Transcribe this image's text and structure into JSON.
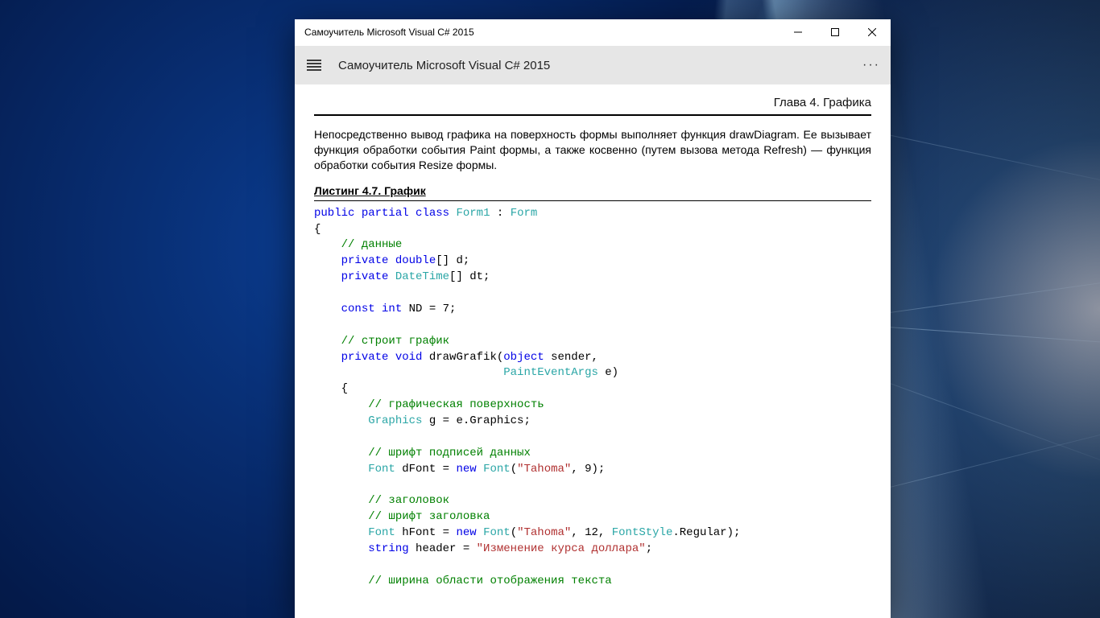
{
  "window": {
    "title": "Самоучитель Microsoft Visual C# 2015"
  },
  "toolbar": {
    "title": "Самоучитель Microsoft Visual C# 2015"
  },
  "chapter": "Глава 4. Графика",
  "intro_paragraph": "Непосредственно вывод графика на поверхность формы выполняет функция drawDiagram. Ее вызывает функция обработки события Paint формы, а также косвенно (путем вызова метода Refresh) — функция обработки события Resize формы.",
  "listing_title": "Листинг 4.7. График",
  "code": {
    "l01": {
      "k1": "public",
      "k2": "partial",
      "k3": "class",
      "t1": "Form1",
      "p": " : ",
      "t2": "Form"
    },
    "l02": "{",
    "l03": {
      "indent": "    ",
      "c": "// данные"
    },
    "l04": {
      "indent": "    ",
      "k1": "private",
      "k2": "double",
      "rest": "[] d;"
    },
    "l05": {
      "indent": "    ",
      "k1": "private",
      "t": "DateTime",
      "rest": "[] dt;"
    },
    "l07": {
      "indent": "    ",
      "k1": "const",
      "k2": "int",
      "rest": " ND = 7;"
    },
    "l09": {
      "indent": "    ",
      "c": "// строит график"
    },
    "l10": {
      "indent": "    ",
      "k1": "private",
      "k2": "void",
      "name": " drawGrafik(",
      "k3": "object",
      "rest": " sender,"
    },
    "l11": {
      "indent": "                            ",
      "t": "PaintEventArgs",
      "rest": " e)"
    },
    "l12": {
      "indent": "    ",
      "txt": "{"
    },
    "l13": {
      "indent": "        ",
      "c": "// графическая поверхность"
    },
    "l14": {
      "indent": "        ",
      "t": "Graphics",
      "rest": " g = e.Graphics;"
    },
    "l16": {
      "indent": "        ",
      "c": "// шрифт подписей данных"
    },
    "l17": {
      "indent": "        ",
      "t1": "Font",
      "mid": " dFont = ",
      "k": "new",
      "sp": " ",
      "t2": "Font",
      "open": "(",
      "s": "\"Tahoma\"",
      "rest": ", 9);"
    },
    "l19": {
      "indent": "        ",
      "c": "// заголовок"
    },
    "l20": {
      "indent": "        ",
      "c": "// шрифт заголовка"
    },
    "l21": {
      "indent": "        ",
      "t1": "Font",
      "mid": " hFont = ",
      "k": "new",
      "sp": " ",
      "t2": "Font",
      "open": "(",
      "s": "\"Tahoma\"",
      "comma": ", 12, ",
      "t3": "FontStyle",
      "rest": ".Regular);"
    },
    "l22": {
      "indent": "        ",
      "k": "string",
      "mid": " header = ",
      "s": "\"Изменение курса доллара\"",
      "rest": ";"
    },
    "l24": {
      "indent": "        ",
      "c": "// ширина области отображения текста"
    }
  }
}
